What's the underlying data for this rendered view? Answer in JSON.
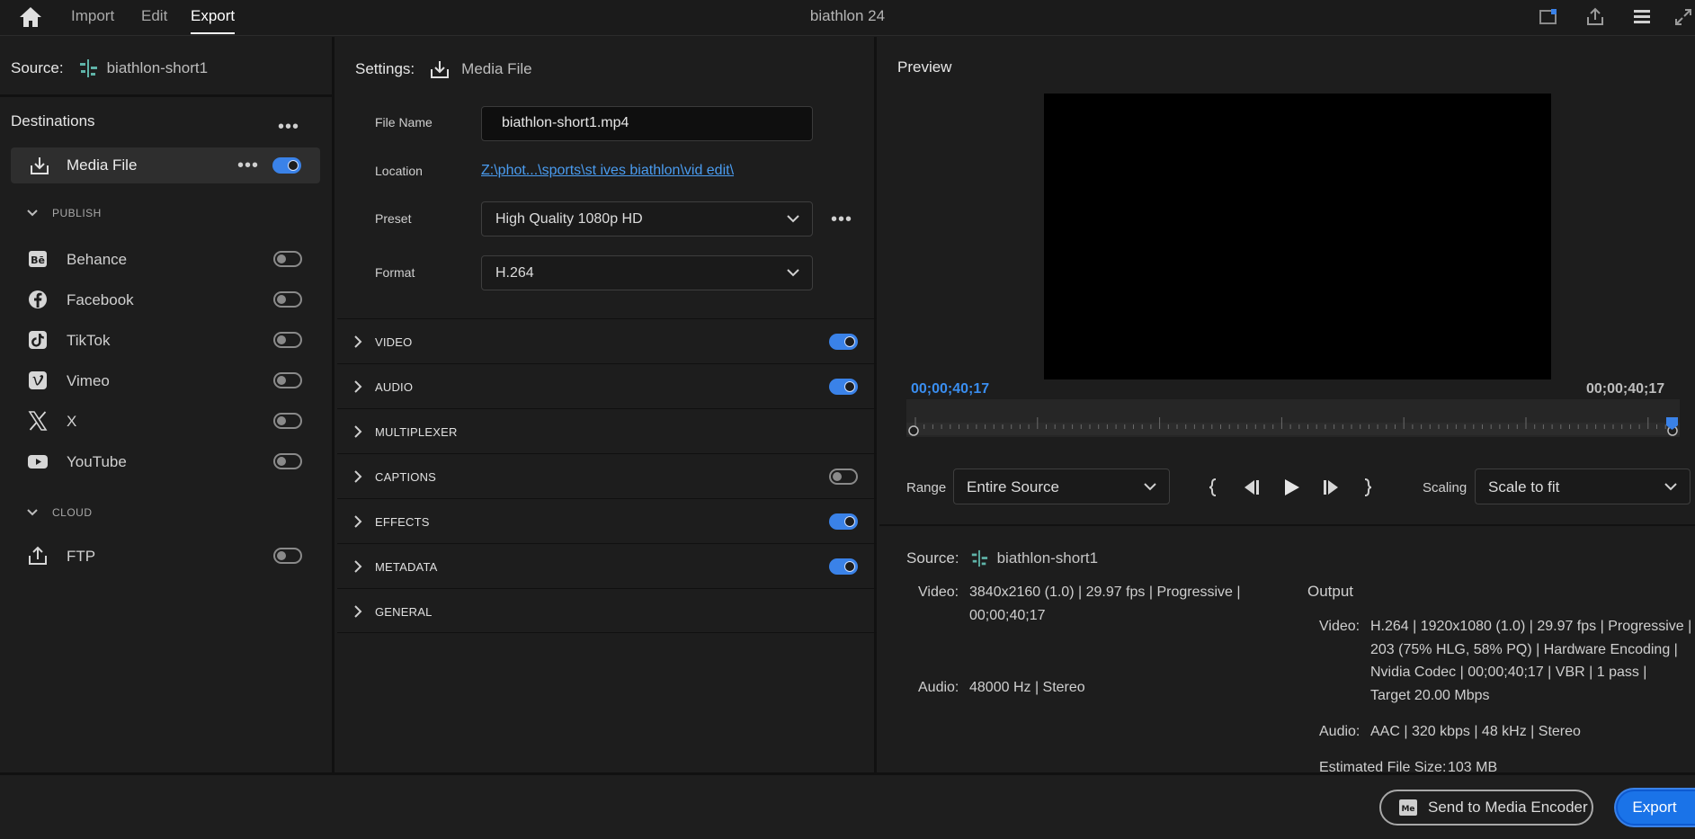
{
  "topbar": {
    "tabs": [
      "Import",
      "Edit",
      "Export"
    ],
    "active_tab": "Export",
    "title": "biathlon 24"
  },
  "left": {
    "source_label": "Source:",
    "source_name": "biathlon-short1",
    "destinations_label": "Destinations",
    "media_file": {
      "label": "Media File",
      "enabled": true
    },
    "publish_label": "PUBLISH",
    "publish": [
      {
        "label": "Behance",
        "icon": "behance-icon",
        "enabled": false
      },
      {
        "label": "Facebook",
        "icon": "facebook-icon",
        "enabled": false
      },
      {
        "label": "TikTok",
        "icon": "tiktok-icon",
        "enabled": false
      },
      {
        "label": "Vimeo",
        "icon": "vimeo-icon",
        "enabled": false
      },
      {
        "label": "X",
        "icon": "x-icon",
        "enabled": false
      },
      {
        "label": "YouTube",
        "icon": "youtube-icon",
        "enabled": false
      }
    ],
    "cloud_label": "CLOUD",
    "cloud": [
      {
        "label": "FTP",
        "icon": "ftp-upload-icon",
        "enabled": false
      }
    ]
  },
  "settings": {
    "label": "Settings:",
    "name": "Media File",
    "file_name_label": "File Name",
    "file_name": "biathlon-short1.mp4",
    "location_label": "Location",
    "location": "Z:\\phot...\\sports\\st ives biathlon\\vid edit\\",
    "preset_label": "Preset",
    "preset": "High Quality 1080p HD",
    "format_label": "Format",
    "format": "H.264",
    "sections": [
      {
        "label": "VIDEO",
        "toggle": "on"
      },
      {
        "label": "AUDIO",
        "toggle": "on"
      },
      {
        "label": "MULTIPLEXER",
        "toggle": "none"
      },
      {
        "label": "CAPTIONS",
        "toggle": "off"
      },
      {
        "label": "EFFECTS",
        "toggle": "on"
      },
      {
        "label": "METADATA",
        "toggle": "on"
      },
      {
        "label": "GENERAL",
        "toggle": "none"
      }
    ]
  },
  "preview": {
    "title": "Preview",
    "timecode_in": "00;00;40;17",
    "timecode_out": "00;00;40;17",
    "range_label": "Range",
    "range": "Entire Source",
    "scaling_label": "Scaling",
    "scaling": "Scale to fit"
  },
  "source_info": {
    "label": "Source:",
    "name": "biathlon-short1",
    "video_label": "Video:",
    "video_line1": "3840x2160 (1.0)  |  29.97 fps  |  Progressive  |",
    "video_line2": "00;00;40;17",
    "audio_label": "Audio:",
    "audio": "48000 Hz  |  Stereo"
  },
  "output_info": {
    "label": "Output",
    "video_label": "Video:",
    "video_lines": [
      "H.264  |  1920x1080 (1.0)  |  29.97 fps  |  Progressive  |",
      "203 (75% HLG, 58% PQ)  |  Hardware Encoding  |",
      "Nvidia Codec  |  00;00;40;17   |  VBR  |  1 pass  |",
      "Target 20.00 Mbps"
    ],
    "audio_label": "Audio:",
    "audio": "AAC  |  320 kbps  |  48 kHz  |  Stereo",
    "size_label": "Estimated File Size:",
    "size": "103 MB"
  },
  "bottom": {
    "encoder_button": "Send to Media Encoder",
    "export_button": "Export"
  },
  "colors": {
    "accent": "#3a82e8",
    "link": "#4a9cf0",
    "background": "#1d1d1d"
  }
}
